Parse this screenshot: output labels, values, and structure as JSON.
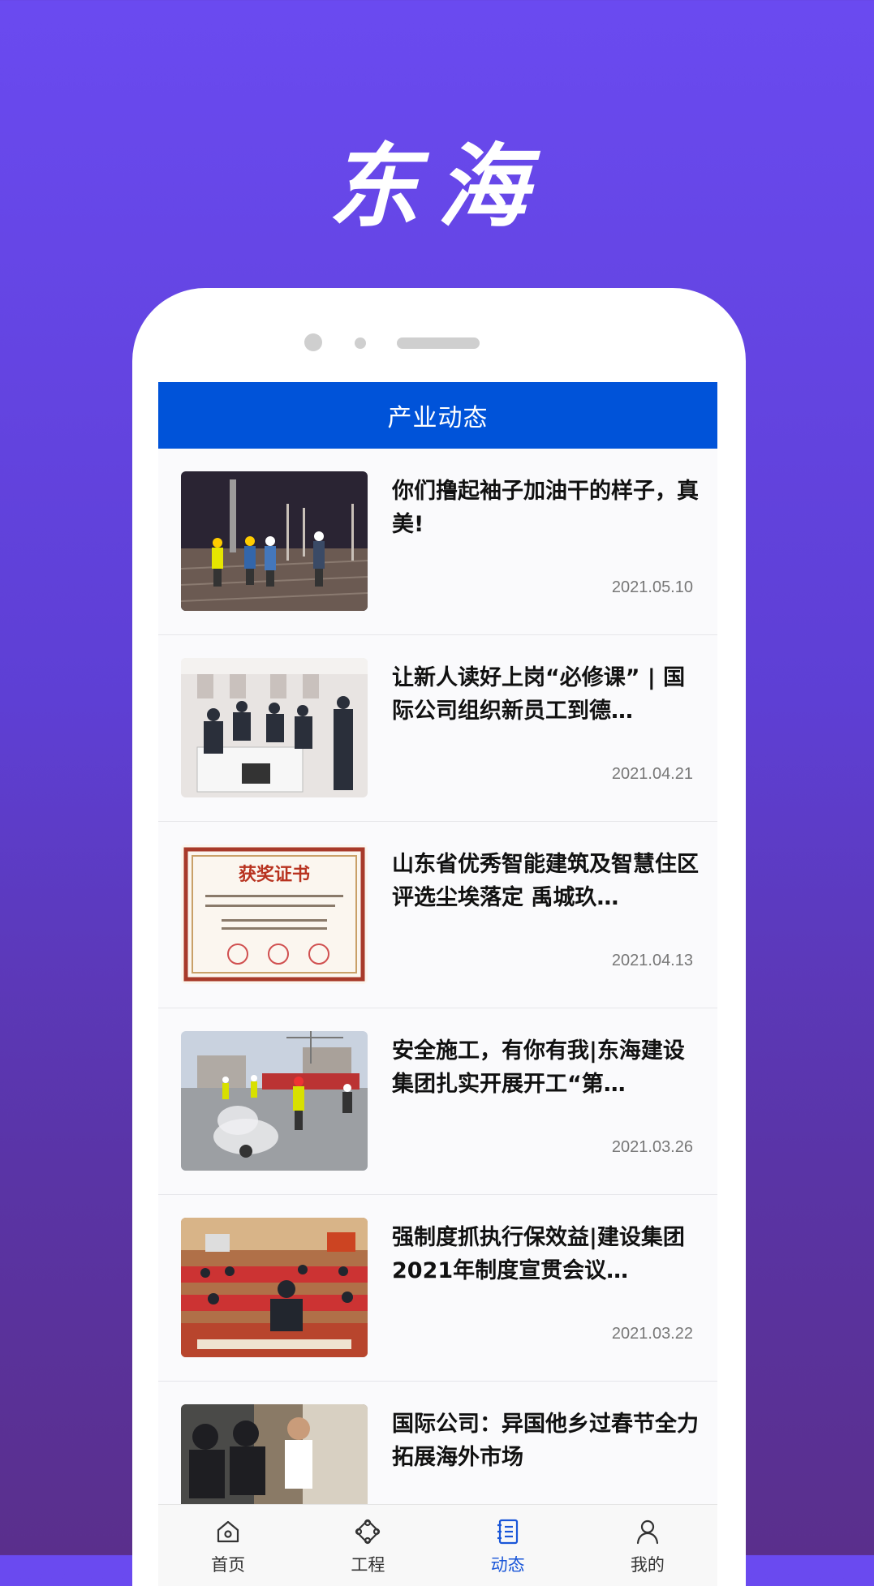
{
  "promo": {
    "title": "东海"
  },
  "header": {
    "title": "产业动态"
  },
  "news": [
    {
      "title": "你们撸起袖子加油干的样子，真美!",
      "date": "2021.05.10"
    },
    {
      "title": "让新人读好上岗“必修课” | 国际公司组织新员工到德…",
      "date": "2021.04.21"
    },
    {
      "title": "山东省优秀智能建筑及智慧住区评选尘埃落定 禹城玖…",
      "date": "2021.04.13"
    },
    {
      "title": "安全施工，有你有我|东海建设集团扎实开展开工“第…",
      "date": "2021.03.26"
    },
    {
      "title": "强制度抓执行保效益|建设集团2021年制度宣贯会议…",
      "date": "2021.03.22"
    },
    {
      "title": "国际公司：异国他乡过春节全力拓展海外市场",
      "date": ""
    }
  ],
  "certificate": {
    "heading": "获奖证书"
  },
  "tabs": [
    {
      "label": "首页",
      "icon": "home-icon"
    },
    {
      "label": "工程",
      "icon": "project-icon"
    },
    {
      "label": "动态",
      "icon": "news-icon",
      "active": true
    },
    {
      "label": "我的",
      "icon": "profile-icon"
    }
  ],
  "colors": {
    "accent": "#0053d9",
    "tab_active": "#1a56d8",
    "background_top": "#6a4af0"
  }
}
